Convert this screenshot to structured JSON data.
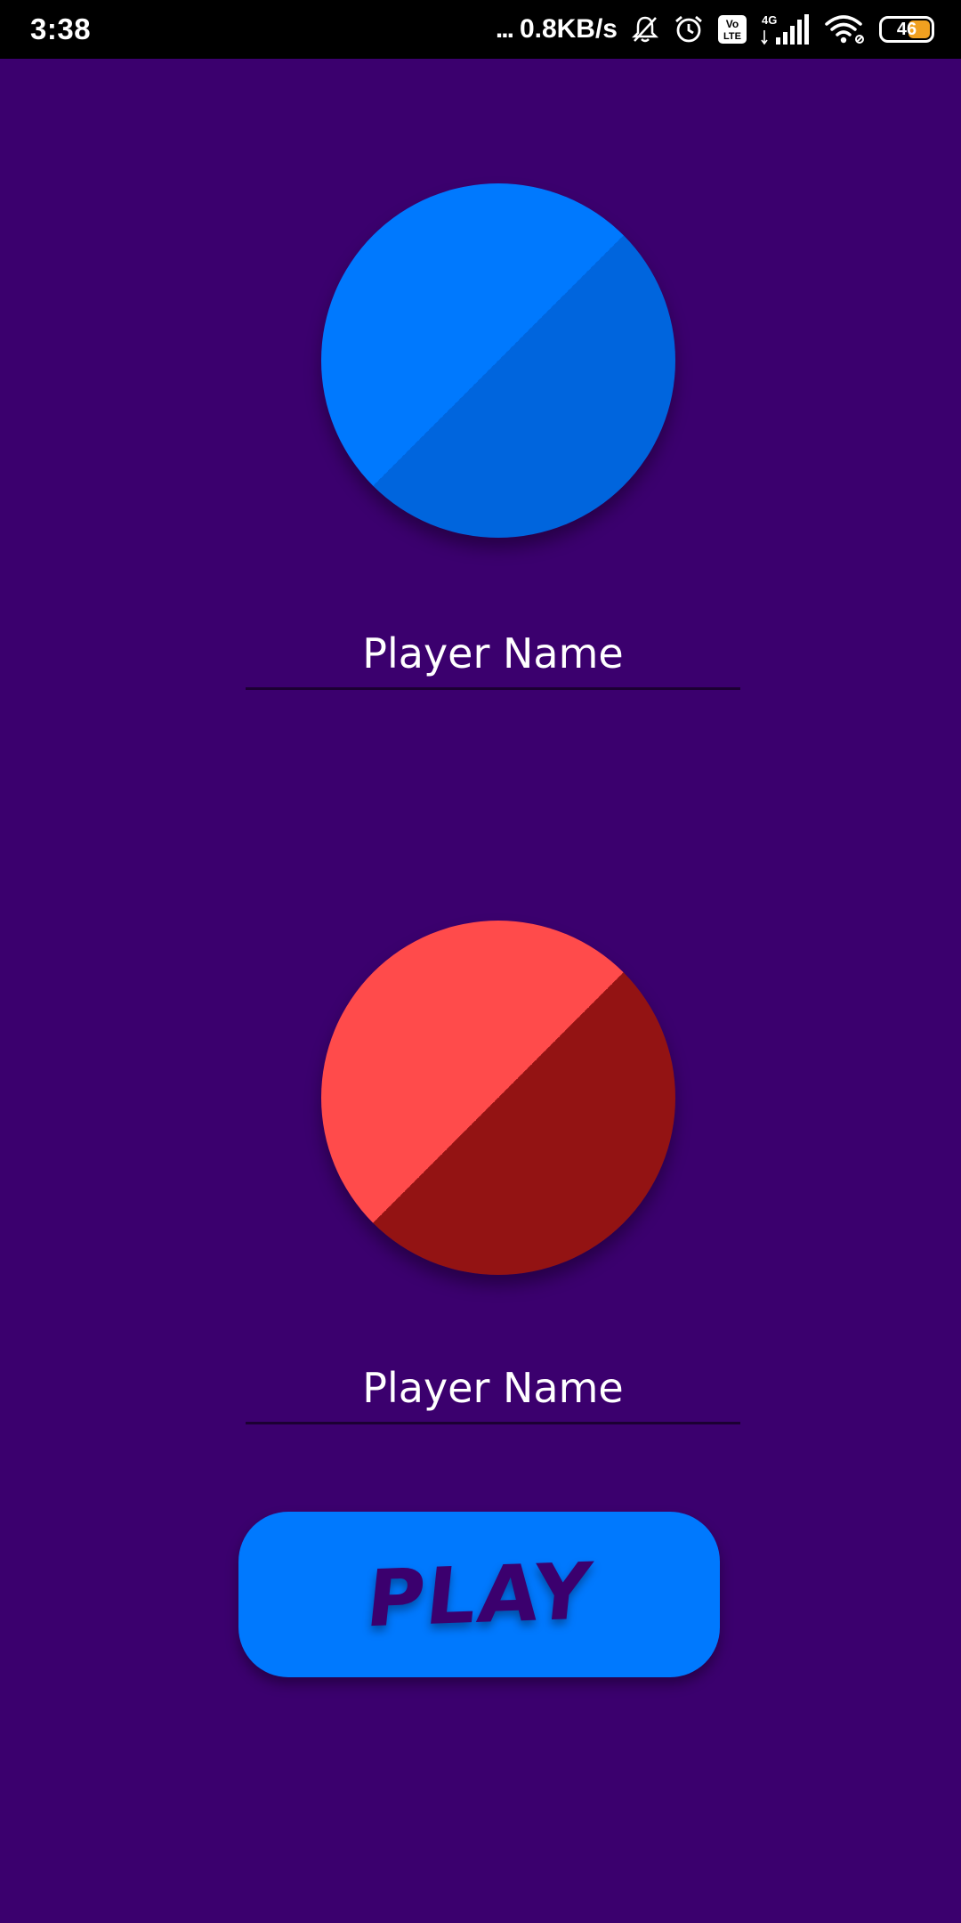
{
  "status_bar": {
    "time": "3:38",
    "dots": "...",
    "network_speed": "0.8KB/s",
    "network_type": "4G",
    "volte_label_top": "Vo",
    "volte_label_bottom": "LTE",
    "battery_level": "46",
    "battery_color": "#f0a020",
    "icons": [
      "bell-muted-icon",
      "alarm-icon",
      "volte-icon",
      "signal-icon",
      "wifi-icon",
      "battery-icon"
    ]
  },
  "players": [
    {
      "disc_color_light": "#0079fe",
      "disc_color_dark": "#0065dd",
      "name_placeholder": "Player Name",
      "name_value": ""
    },
    {
      "disc_color_light": "#ff4b4b",
      "disc_color_dark": "#931313",
      "name_placeholder": "Player Name",
      "name_value": ""
    }
  ],
  "play_button": {
    "label": "PLAY",
    "color": "#0079fe"
  },
  "colors": {
    "background": "#3b006e",
    "accent": "#0079fe"
  }
}
